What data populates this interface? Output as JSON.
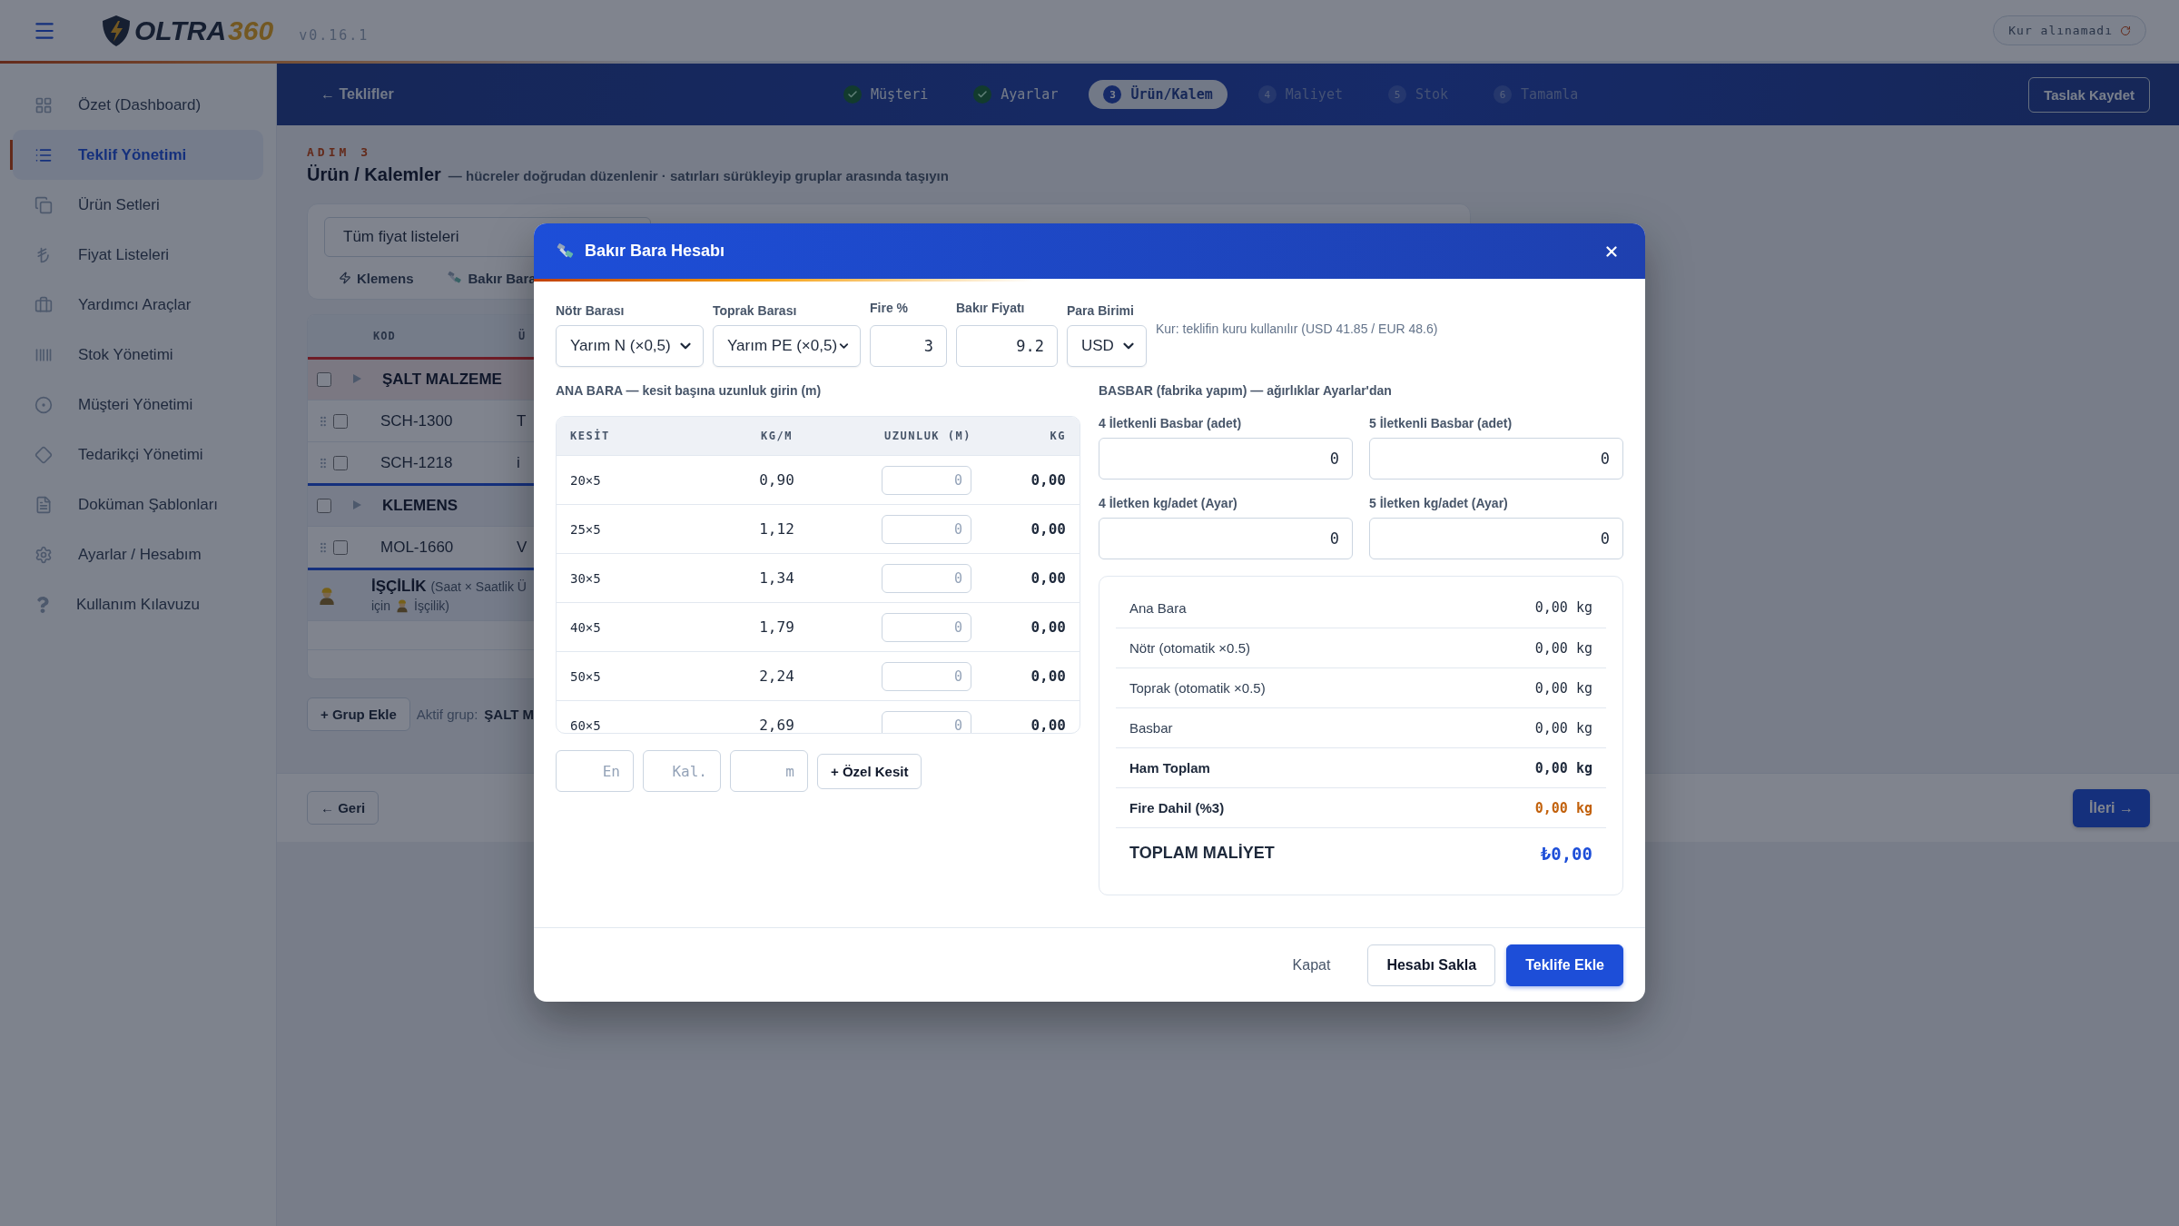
{
  "topbar": {
    "logo_main": "OLTRA",
    "logo_accent": "360",
    "version": "v0.16.1",
    "rate_status": "Kur alınamadı"
  },
  "sidebar": {
    "items": [
      {
        "label": "Özet (Dashboard)",
        "selected": false
      },
      {
        "label": "Teklif Yönetimi",
        "selected": true
      },
      {
        "label": "Ürün Setleri",
        "selected": false
      },
      {
        "label": "Fiyat Listeleri",
        "selected": false
      },
      {
        "label": "Yardımcı Araçlar",
        "selected": false
      },
      {
        "label": "Stok Yönetimi",
        "selected": false
      },
      {
        "label": "Müşteri Yönetimi",
        "selected": false
      },
      {
        "label": "Tedarikçi Yönetimi",
        "selected": false
      },
      {
        "label": "Doküman Şablonları",
        "selected": false
      },
      {
        "label": "Ayarlar / Hesabım",
        "selected": false
      },
      {
        "label": "Kullanım Kılavuzu",
        "selected": false
      }
    ]
  },
  "header": {
    "back_link": "← Teklifler",
    "steps": [
      {
        "label": "Müşteri",
        "completed": true,
        "selected": false
      },
      {
        "label": "Ayarlar",
        "completed": true,
        "selected": false
      },
      {
        "number": "3",
        "label": "Ürün/Kalem",
        "completed": false,
        "selected": true
      },
      {
        "number": "4",
        "label": "Maliyet",
        "completed": false,
        "selected": false
      },
      {
        "number": "5",
        "label": "Stok",
        "completed": false,
        "selected": false
      },
      {
        "number": "6",
        "label": "Tamamla",
        "completed": false,
        "selected": false
      }
    ],
    "save_button": "Taslak Kaydet"
  },
  "page": {
    "step_label": "ADIM 3",
    "title": "Ürün / Kalemler",
    "subtitle": "— hücreler doğrudan düzenlenir · satırları sürükleyip gruplar arasında taşıyın",
    "price_list": "Tüm fiyat listeleri",
    "quick_actions": [
      {
        "label": "Klemens"
      },
      {
        "label": "Bakır Bara"
      }
    ],
    "table": {
      "columns": [
        "KOD",
        "Ü"
      ],
      "rows": [
        {
          "kind": "group",
          "title": "ŞALT MALZEME",
          "checked": false
        },
        {
          "kind": "item",
          "code": "SCH-1300",
          "column_2": "T",
          "checked": false
        },
        {
          "kind": "item",
          "code": "SCH-1218",
          "column_2": "i",
          "checked": false
        },
        {
          "kind": "group",
          "title": "KLEMENS",
          "checked": false
        },
        {
          "kind": "item",
          "code": "MOL-1660",
          "column_2": "V",
          "checked": false
        },
        {
          "kind": "labor",
          "title": "İŞÇİLİK",
          "note": "(Saat × Saatlik Ü",
          "note_before": "için",
          "note_after": "İşçilik)"
        },
        {
          "kind": "empty"
        },
        {
          "kind": "empty"
        }
      ]
    },
    "add_group": "+ Grup Ekle",
    "active_group_label": "Aktif grup:",
    "active_group": "ŞALT M"
  },
  "footer": {
    "back": "← Geri",
    "next": "İleri →"
  },
  "modal": {
    "title": "Bakır Bara Hesabı",
    "settings": [
      {
        "kind": "select",
        "label": "Nötr Barası",
        "value": "Yarım N (×0,5)"
      },
      {
        "kind": "select",
        "label": "Toprak Barası",
        "value": "Yarım PE (×0,5)"
      },
      {
        "kind": "number",
        "label": "Fire %",
        "value": "3"
      },
      {
        "kind": "number",
        "label": "Bakır Fiyatı",
        "value": "9.2"
      },
      {
        "kind": "select",
        "label": "Para Birimi",
        "value": "USD"
      }
    ],
    "rate_note": "Kur: teklifin kuru kullanılır (USD 41.85 / EUR 48.6)",
    "main_bar": {
      "heading": "ANA BARA — kesit başına uzunluk girin (m)",
      "columns": [
        "KESİT",
        "KG/M",
        "UZUNLUK (M)",
        "KG"
      ],
      "rows": [
        {
          "section": "20×5",
          "kg_per_m": "0,90",
          "length_placeholder": "0",
          "kg": "0,00"
        },
        {
          "section": "25×5",
          "kg_per_m": "1,12",
          "length_placeholder": "0",
          "kg": "0,00"
        },
        {
          "section": "30×5",
          "kg_per_m": "1,34",
          "length_placeholder": "0",
          "kg": "0,00"
        },
        {
          "section": "40×5",
          "kg_per_m": "1,79",
          "length_placeholder": "0",
          "kg": "0,00"
        },
        {
          "section": "50×5",
          "kg_per_m": "2,24",
          "length_placeholder": "0",
          "kg": "0,00"
        },
        {
          "section": "60×5",
          "kg_per_m": "2,69",
          "length_placeholder": "0",
          "kg": "0,00"
        }
      ],
      "custom": {
        "width_placeholder": "En",
        "thickness_placeholder": "Kal.",
        "length_placeholder": "m",
        "add_button": "+ Özel Kesit"
      }
    },
    "busbar": {
      "heading": "BASBAR (fabrika yapım) — ağırlıklar Ayarlar'dan",
      "fields": [
        {
          "label": "4 İletkenli Basbar (adet)",
          "value": "0"
        },
        {
          "label": "5 İletkenli Basbar (adet)",
          "value": "0"
        },
        {
          "label": "4 İletken kg/adet (Ayar)",
          "value": "0"
        },
        {
          "label": "5 İletken kg/adet (Ayar)",
          "value": "0"
        }
      ]
    },
    "summary": [
      {
        "kind": "normal",
        "label": "Ana Bara",
        "value": "0,00 kg"
      },
      {
        "kind": "normal",
        "label": "Nötr (otomatik ×0.5)",
        "value": "0,00 kg"
      },
      {
        "kind": "normal",
        "label": "Toprak (otomatik ×0.5)",
        "value": "0,00 kg"
      },
      {
        "kind": "normal",
        "label": "Basbar",
        "value": "0,00 kg"
      },
      {
        "kind": "bold",
        "label": "Ham Toplam",
        "value": "0,00 kg"
      },
      {
        "kind": "fire",
        "label": "Fire Dahil (%3)",
        "value": "0,00 kg"
      },
      {
        "kind": "total",
        "label": "TOPLAM MALİYET",
        "value": "₺0,00"
      }
    ],
    "buttons": [
      {
        "kind": "text",
        "label": "Kapat"
      },
      {
        "kind": "outline",
        "label": "Hesabı Sakla"
      },
      {
        "kind": "primary",
        "label": "Teklife Ekle"
      }
    ]
  }
}
